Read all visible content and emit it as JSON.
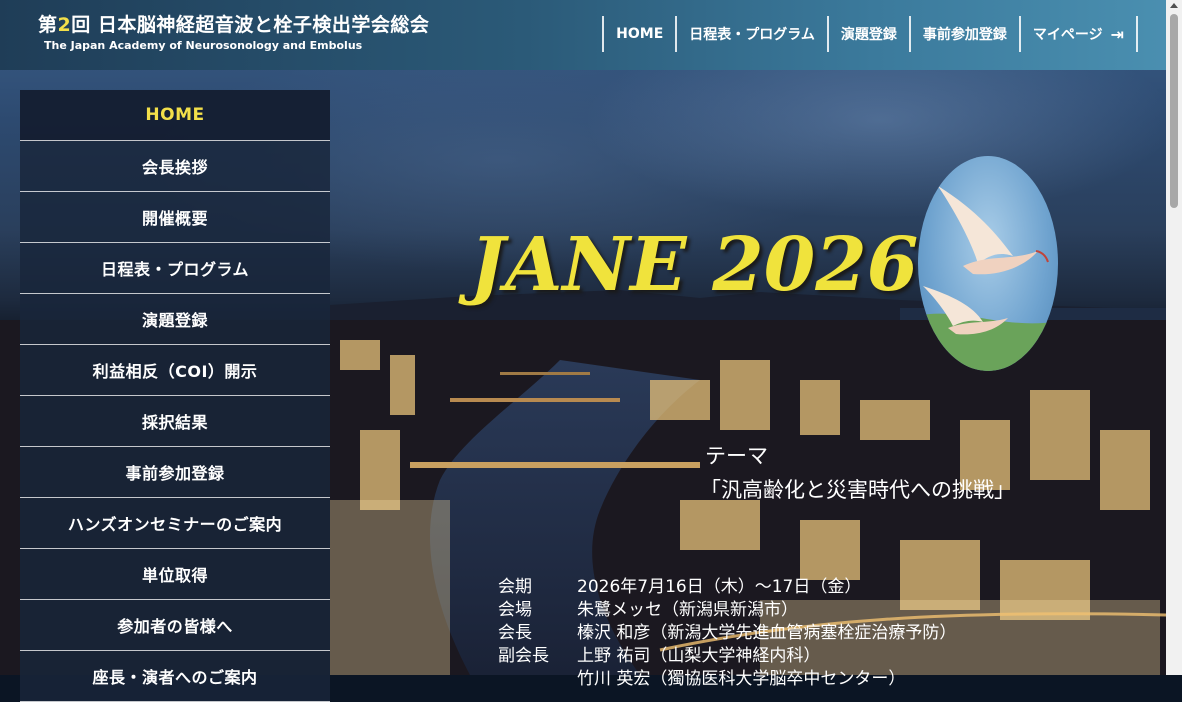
{
  "header": {
    "title_prefix": "第",
    "title_number": "2",
    "title_suffix": "回 日本脳神経超音波と栓子検出学会総会",
    "subtitle": "The Japan Academy of Neurosonology and Embolus"
  },
  "topnav": [
    {
      "label": "HOME"
    },
    {
      "label": "日程表・プログラム"
    },
    {
      "label": "演題登録"
    },
    {
      "label": "事前参加登録"
    },
    {
      "label": "マイページ"
    }
  ],
  "sidebar": [
    {
      "label": "HOME"
    },
    {
      "label": "会長挨拶"
    },
    {
      "label": "開催概要"
    },
    {
      "label": "日程表・プログラム"
    },
    {
      "label": "演題登録"
    },
    {
      "label": "利益相反（COI）開示"
    },
    {
      "label": "採択結果"
    },
    {
      "label": "事前参加登録"
    },
    {
      "label": "ハンズオンセミナーのご案内"
    },
    {
      "label": "単位取得"
    },
    {
      "label": "参加者の皆様へ"
    },
    {
      "label": "座長・演者へのご案内"
    }
  ],
  "hero": {
    "title": "JANE 2026",
    "theme_label": "テーマ",
    "theme_text": "「汎高齢化と災害時代への挑戦」"
  },
  "info": [
    {
      "label": "会期",
      "value": "2026年7月16日（木）～17日（金）"
    },
    {
      "label": "会場",
      "value": "朱鷺メッセ（新潟県新潟市）"
    },
    {
      "label": "会長",
      "value": "榛沢 和彦（新潟大学先進血管病塞栓症治療予防）"
    },
    {
      "label": "副会長",
      "value": "上野 祐司（山梨大学神経内科）"
    },
    {
      "label": "",
      "value": "竹川 英宏（獨協医科大学脳卒中センター）"
    }
  ],
  "colors": {
    "accent_yellow": "#f0e33c",
    "header_blue": "#2b5a78",
    "sidebar_bg": "#18263a"
  }
}
